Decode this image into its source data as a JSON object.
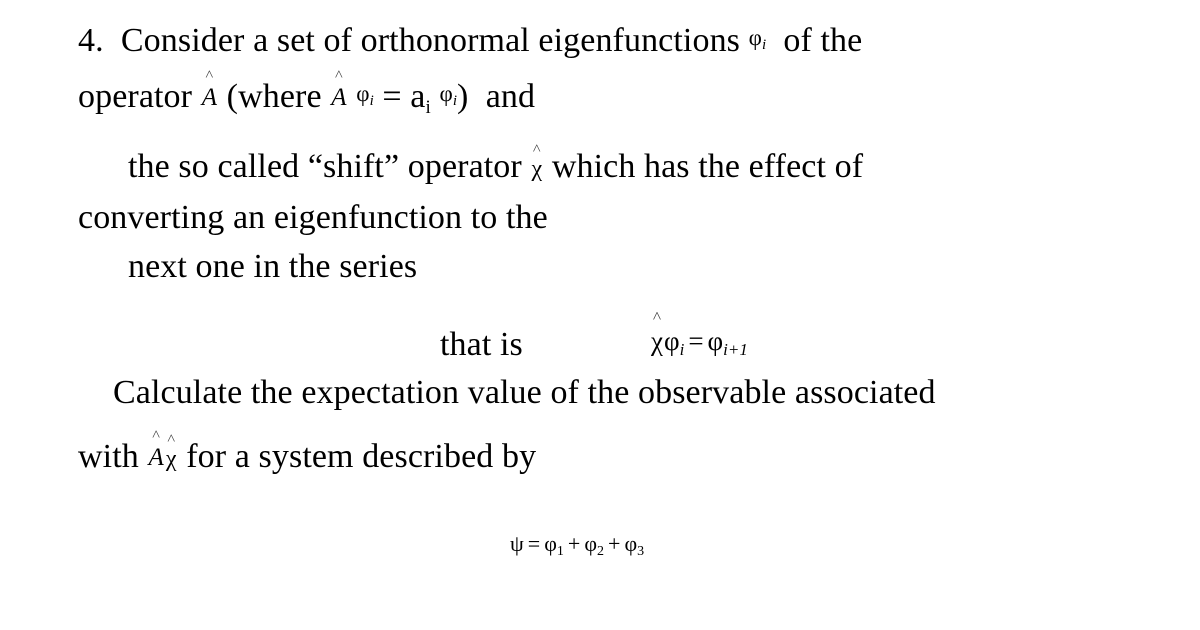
{
  "document": {
    "kind": "worksheet-problem",
    "background_color": "#ffffff",
    "text_color": "#000000",
    "problem_number": "4.",
    "lines": {
      "l1_a": "Consider a set of orthonormal eigenfunctions",
      "l1_b": "of the",
      "l2_a": "operator",
      "l2_b": "(where",
      "l2_c": "=",
      "l2_d": "a",
      "l2_e": ")",
      "l2_f": "and",
      "l3_a": "the so called “shift” operator",
      "l3_b": "which has the effect of",
      "l4": "converting an eigenfunction to the",
      "l5": "next one in the series",
      "l6_that_is": "that is",
      "l7": "Calculate the expectation value of the observable associated",
      "l8_a": "with",
      "l8_b": "for a system described by"
    },
    "symbols": {
      "phi": "φ",
      "psi": "ψ",
      "chi": "χ",
      "A": "A",
      "hat": "˄",
      "equals": "=",
      "plus": "+",
      "sub_i": "i",
      "sub_i_plus_1": "i+1",
      "sub_1": "1",
      "sub_2": "2",
      "sub_3": "3"
    },
    "equations": {
      "shift_relation": {
        "lhs_operator": "χ",
        "lhs_function": "φ",
        "lhs_index": "i",
        "relation": "=",
        "rhs_function": "φ",
        "rhs_index": "i+1",
        "plain": "χ̂ φᵢ = φᵢ₊₁"
      },
      "state": {
        "lhs": "ψ",
        "relation": "=",
        "terms": [
          "φ₁",
          "φ₂",
          "φ₃"
        ],
        "plain": "ψ = φ₁ + φ₂ + φ₃"
      }
    }
  }
}
